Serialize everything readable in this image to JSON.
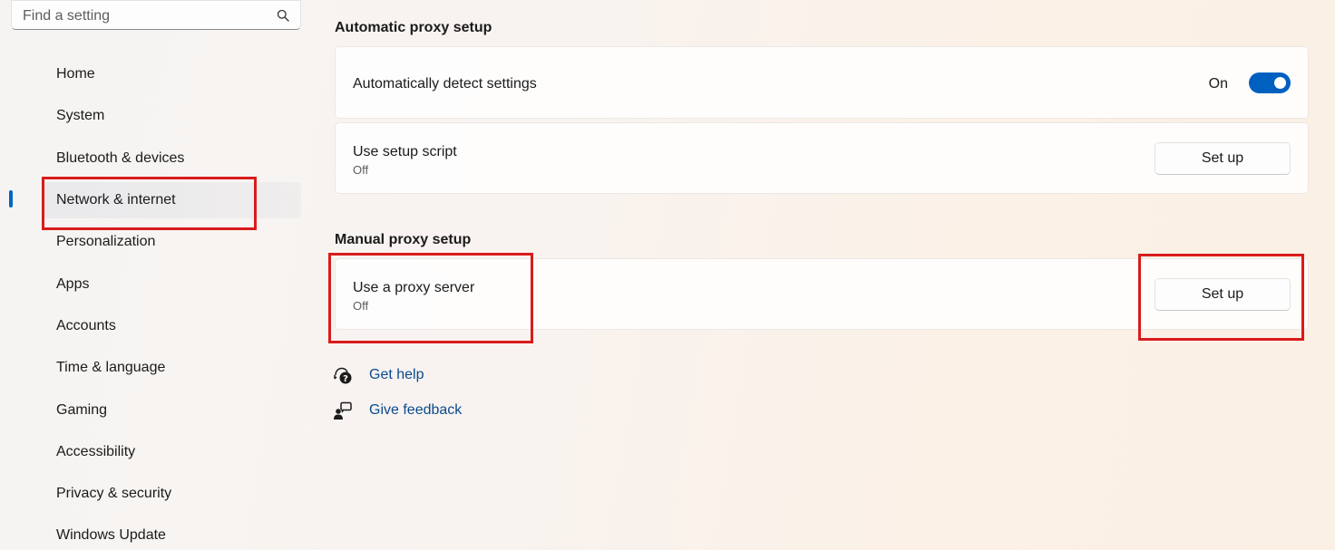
{
  "search": {
    "placeholder": "Find a setting",
    "icon": "search-icon"
  },
  "sidebar": {
    "items": [
      {
        "label": "Home",
        "selected": false
      },
      {
        "label": "System",
        "selected": false
      },
      {
        "label": "Bluetooth & devices",
        "selected": false
      },
      {
        "label": "Network & internet",
        "selected": true
      },
      {
        "label": "Personalization",
        "selected": false
      },
      {
        "label": "Apps",
        "selected": false
      },
      {
        "label": "Accounts",
        "selected": false
      },
      {
        "label": "Time & language",
        "selected": false
      },
      {
        "label": "Gaming",
        "selected": false
      },
      {
        "label": "Accessibility",
        "selected": false
      },
      {
        "label": "Privacy & security",
        "selected": false
      },
      {
        "label": "Windows Update",
        "selected": false
      }
    ]
  },
  "main": {
    "automatic": {
      "heading": "Automatic proxy setup",
      "detect": {
        "label": "Automatically detect settings",
        "state_label": "On",
        "enabled": true
      },
      "script": {
        "label": "Use setup script",
        "status": "Off",
        "button": "Set up"
      }
    },
    "manual": {
      "heading": "Manual proxy setup",
      "proxy": {
        "label": "Use a proxy server",
        "status": "Off",
        "button": "Set up"
      }
    },
    "links": {
      "help": {
        "label": "Get help",
        "icon": "help-chat-icon"
      },
      "feedback": {
        "label": "Give feedback",
        "icon": "feedback-icon"
      }
    }
  },
  "colors": {
    "accent": "#0067c0",
    "toggle_on": "#0060c0",
    "highlight_box": "#d81c1c",
    "link": "#0a4a8f"
  }
}
